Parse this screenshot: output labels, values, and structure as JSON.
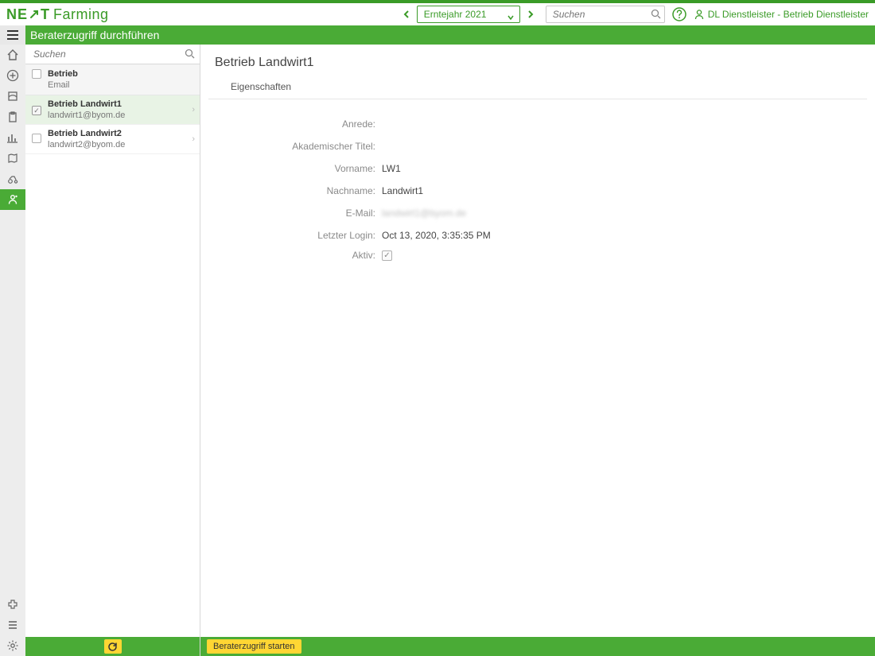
{
  "brand": {
    "part1": "NE",
    "part2": "T",
    "part3": "Farming"
  },
  "year_selector": {
    "label": "Erntejahr 2021"
  },
  "global_search": {
    "placeholder": "Suchen"
  },
  "user": {
    "label": "DL Dienstleister - Betrieb Dienstleister"
  },
  "page_title": "Beraterzugriff durchführen",
  "list": {
    "search_placeholder": "Suchen",
    "header_primary": "Betrieb",
    "header_secondary": "Email",
    "rows": [
      {
        "name": "Betrieb Landwirt1",
        "email": "landwirt1@byom.de",
        "checked": true,
        "selected": true
      },
      {
        "name": "Betrieb Landwirt2",
        "email": "landwirt2@byom.de",
        "checked": false,
        "selected": false
      }
    ]
  },
  "detail": {
    "title": "Betrieb Landwirt1",
    "section": "Eigenschaften",
    "labels": {
      "anrede": "Anrede:",
      "titel": "Akademischer Titel:",
      "vorname": "Vorname:",
      "nachname": "Nachname:",
      "email": "E-Mail:",
      "login": "Letzter Login:",
      "aktiv": "Aktiv:"
    },
    "values": {
      "anrede": "",
      "titel": "",
      "vorname": "LW1",
      "nachname": "Landwirt1",
      "email": "landwirt1@byom.de",
      "login": "Oct 13, 2020, 3:35:35 PM",
      "aktiv": true
    }
  },
  "actions": {
    "start": "Beraterzugriff starten"
  }
}
